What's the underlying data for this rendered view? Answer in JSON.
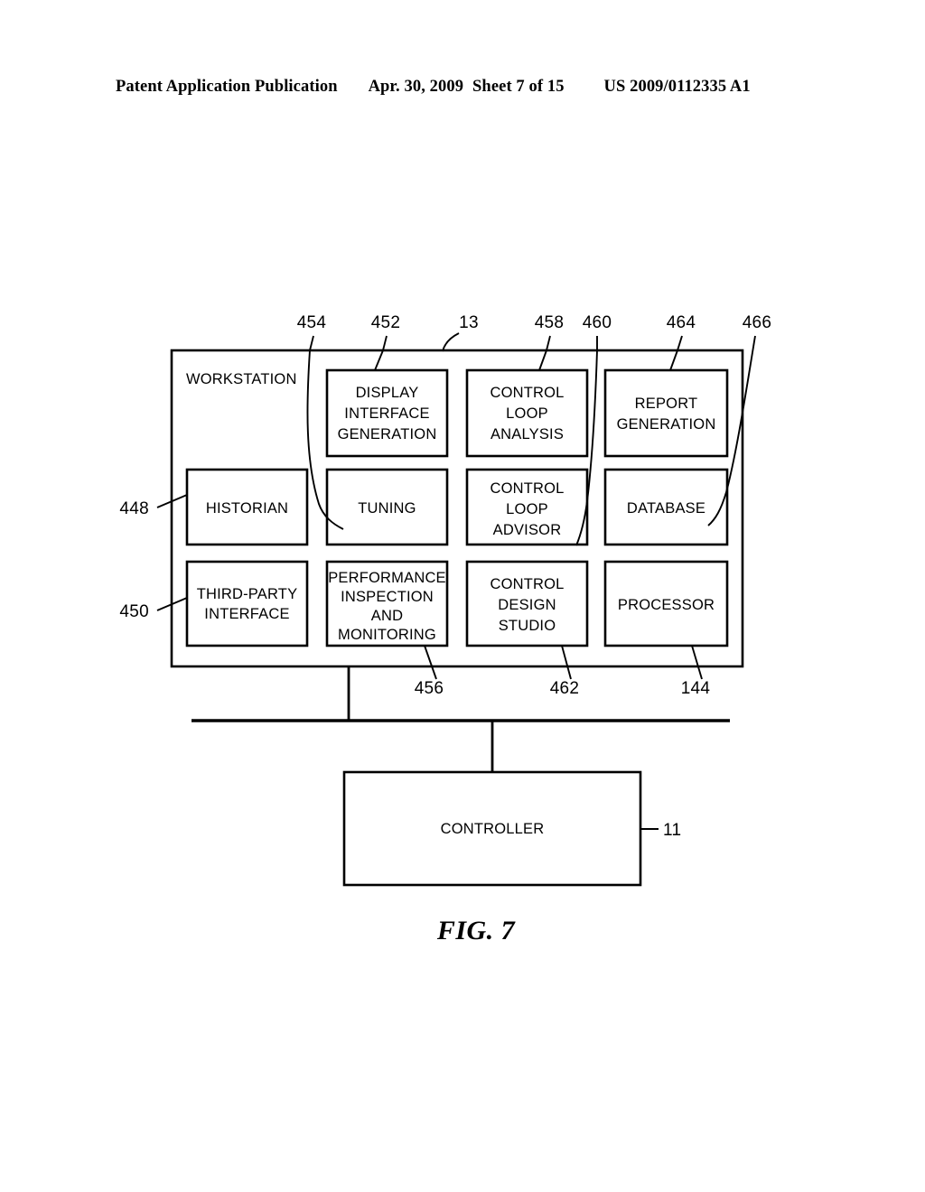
{
  "header": {
    "publication": "Patent Application Publication",
    "date": "Apr. 30, 2009",
    "sheet": "Sheet 7 of 15",
    "patent_number": "US 2009/0112335 A1"
  },
  "figure": {
    "caption": "FIG. 7",
    "frame_label": "WORKSTATION"
  },
  "boxes": {
    "display_interface_generation": "DISPLAY\nINTERFACE\nGENERATION",
    "control_loop_analysis": "CONTROL\nLOOP\nANALYSIS",
    "report_generation": "REPORT\nGENERATION",
    "historian": "HISTORIAN",
    "tuning": "TUNING",
    "control_loop_advisor": "CONTROL\nLOOP\nADVISOR",
    "database": "DATABASE",
    "third_party_interface": "THIRD-PARTY\nINTERFACE",
    "performance_inspection_and_monitoring": "PERFORMANCE\nINSPECTION\nAND\nMONITORING",
    "control_design_studio": "CONTROL\nDESIGN\nSTUDIO",
    "processor": "PROCESSOR",
    "controller": "CONTROLLER"
  },
  "box_lines": {
    "display_interface_generation": [
      "DISPLAY",
      "INTERFACE",
      "GENERATION"
    ],
    "control_loop_analysis": [
      "CONTROL",
      "LOOP",
      "ANALYSIS"
    ],
    "report_generation": [
      "REPORT",
      "GENERATION"
    ],
    "historian": [
      "HISTORIAN"
    ],
    "tuning": [
      "TUNING"
    ],
    "control_loop_advisor": [
      "CONTROL",
      "LOOP",
      "ADVISOR"
    ],
    "database": [
      "DATABASE"
    ],
    "third_party_interface": [
      "THIRD-PARTY",
      "INTERFACE"
    ],
    "performance_inspection_and_monitoring": [
      "PERFORMANCE",
      "INSPECTION",
      "AND",
      "MONITORING"
    ],
    "control_design_studio": [
      "CONTROL",
      "DESIGN",
      "STUDIO"
    ],
    "processor": [
      "PROCESSOR"
    ],
    "controller": [
      "CONTROLLER"
    ]
  },
  "reference_numerals": {
    "top": {
      "n454": "454",
      "n452": "452",
      "n13": "13",
      "n458": "458",
      "n460": "460",
      "n464": "464",
      "n466": "466"
    },
    "left": {
      "n448": "448",
      "n450": "450"
    },
    "bottom": {
      "n456": "456",
      "n462": "462",
      "n144": "144"
    },
    "controller": {
      "n11": "11"
    }
  },
  "colors": {
    "ink": "#000000",
    "paper": "#ffffff"
  }
}
